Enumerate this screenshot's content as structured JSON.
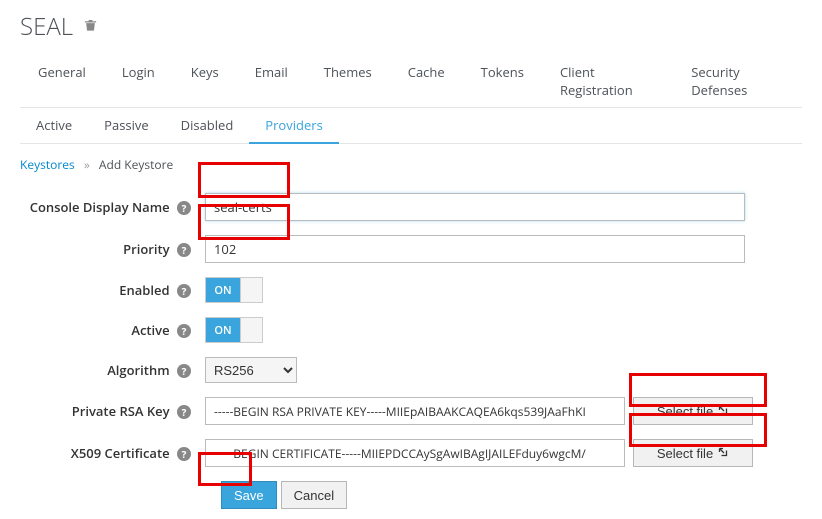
{
  "page": {
    "title": "SEAL"
  },
  "tabs_main": [
    "General",
    "Login",
    "Keys",
    "Email",
    "Themes",
    "Cache",
    "Tokens",
    "Client Registration",
    "Security Defenses"
  ],
  "tabs_sub": [
    "Active",
    "Passive",
    "Disabled",
    "Providers"
  ],
  "tabs_sub_active": 3,
  "breadcrumb": {
    "parent": "Keystores",
    "current": "Add Keystore"
  },
  "form": {
    "display_name": {
      "label": "Console Display Name",
      "value": "seal-certs"
    },
    "priority": {
      "label": "Priority",
      "value": "102"
    },
    "enabled": {
      "label": "Enabled",
      "value": "ON"
    },
    "active": {
      "label": "Active",
      "value": "ON"
    },
    "algorithm": {
      "label": "Algorithm",
      "value": "RS256"
    },
    "private_key": {
      "label": "Private RSA Key",
      "value": "-----BEGIN RSA PRIVATE KEY-----MIIEpAIBAAKCAQEA6kqs539JAaFhKI",
      "button": "Select file"
    },
    "x509": {
      "label": "X509 Certificate",
      "value": "-----BEGIN CERTIFICATE-----MIIEPDCCAySgAwIBAgIJAILEFduy6wgcM/",
      "button": "Select file"
    }
  },
  "buttons": {
    "save": "Save",
    "cancel": "Cancel"
  }
}
